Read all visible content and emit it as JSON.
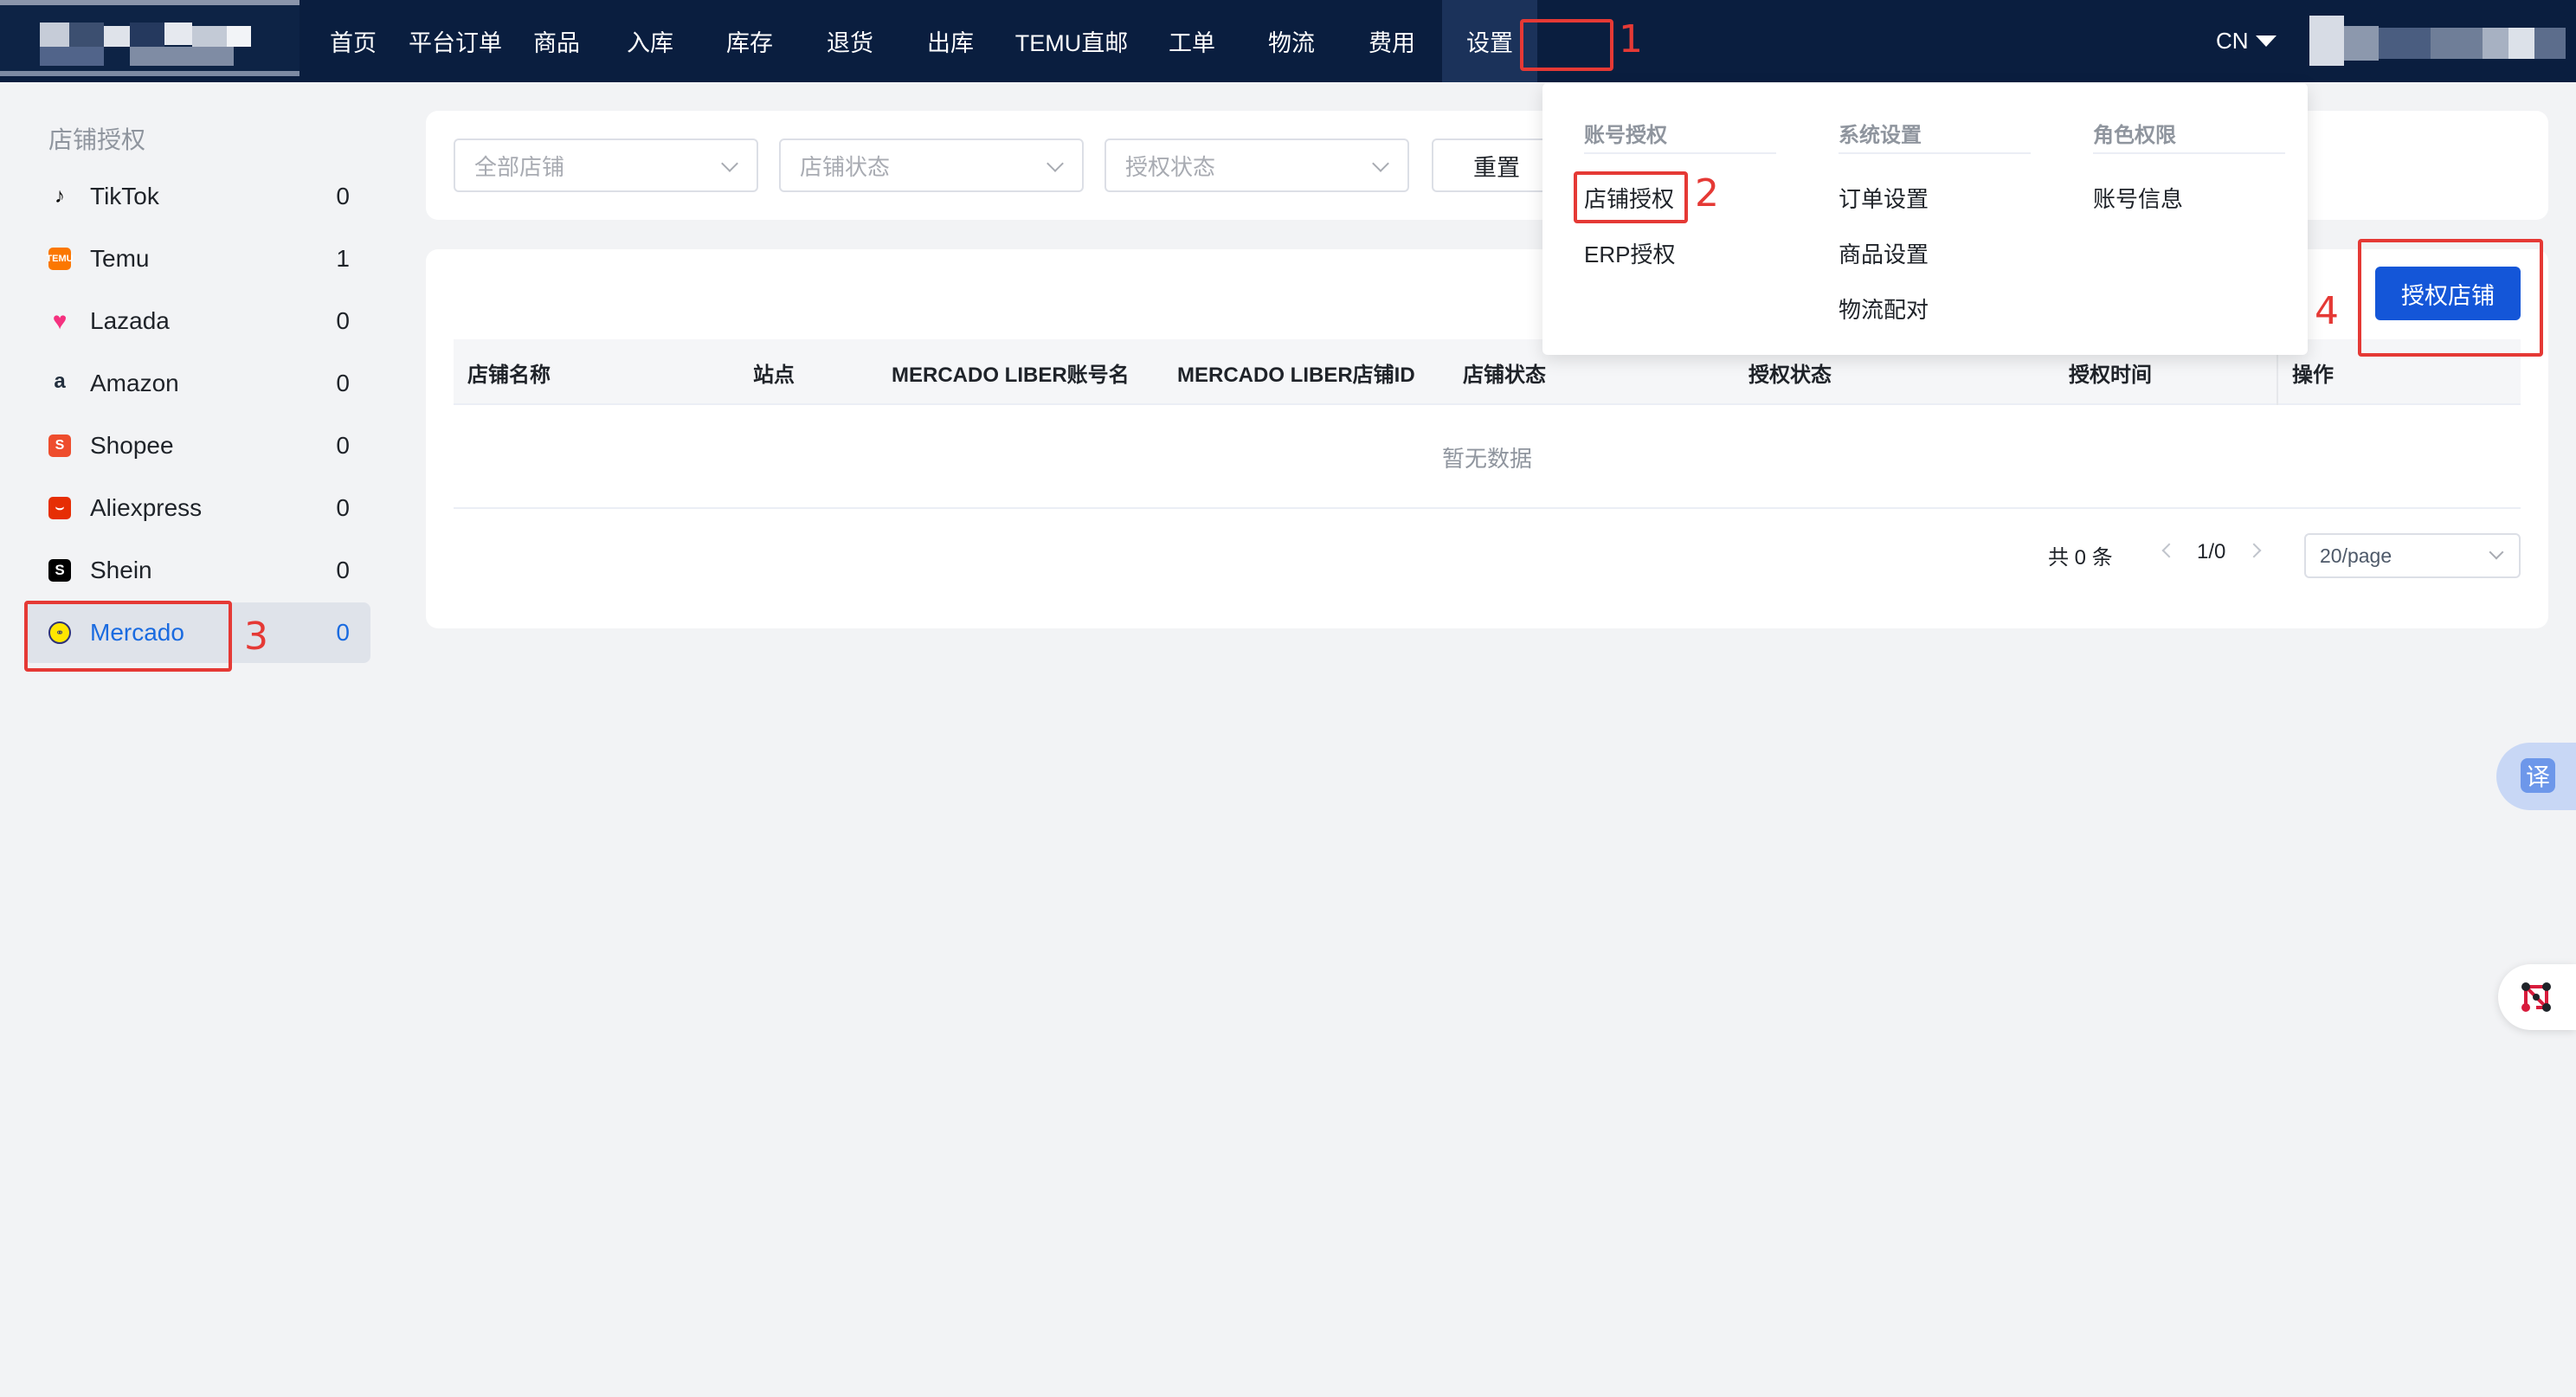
{
  "nav": {
    "items": [
      "首页",
      "平台订单",
      "商品",
      "入库",
      "库存",
      "退货",
      "出库",
      "TEMU直邮",
      "工单",
      "物流",
      "费用",
      "设置"
    ],
    "active": "设置",
    "language": "CN"
  },
  "sidebar": {
    "title": "店铺授权",
    "items": [
      {
        "label": "TikTok",
        "count": "0",
        "icon": "tiktok-icon",
        "color": "#000000"
      },
      {
        "label": "Temu",
        "count": "1",
        "icon": "temu-icon",
        "color": "#fb7701"
      },
      {
        "label": "Lazada",
        "count": "0",
        "icon": "lazada-icon",
        "color": "#f5317f"
      },
      {
        "label": "Amazon",
        "count": "0",
        "icon": "amazon-icon",
        "color": "#232f3e"
      },
      {
        "label": "Shopee",
        "count": "0",
        "icon": "shopee-icon",
        "color": "#ee4d2d"
      },
      {
        "label": "Aliexpress",
        "count": "0",
        "icon": "aliexpress-icon",
        "color": "#e62e04"
      },
      {
        "label": "Shein",
        "count": "0",
        "icon": "shein-icon",
        "color": "#000000"
      },
      {
        "label": "Mercado",
        "count": "0",
        "icon": "mercado-icon",
        "color": "#ffe600"
      }
    ],
    "active": "Mercado"
  },
  "filters": {
    "store": "全部店铺",
    "store_status": "店铺状态",
    "auth_status": "授权状态",
    "reset": "重置"
  },
  "table": {
    "columns": [
      "店铺名称",
      "站点",
      "MERCADO LIBER账号名",
      "MERCADO LIBER店铺ID",
      "店铺状态",
      "授权状态",
      "授权时间",
      "操作"
    ],
    "empty_text": "暂无数据"
  },
  "actions": {
    "authorize_store": "授权店铺"
  },
  "pagination": {
    "total": "共 0 条",
    "current": "1/0",
    "page_size": "20/page"
  },
  "dropdown": {
    "columns": [
      {
        "title": "账号授权",
        "items": [
          "店铺授权",
          "ERP授权"
        ]
      },
      {
        "title": "系统设置",
        "items": [
          "订单设置",
          "商品设置",
          "物流配对"
        ]
      },
      {
        "title": "角色权限",
        "items": [
          "账号信息"
        ]
      }
    ]
  },
  "annotations": [
    "1",
    "2",
    "3",
    "4"
  ],
  "floating": {
    "translate": "译"
  },
  "colors": {
    "nav_bg": "#0a1e3f",
    "primary": "#1456d8",
    "annotation": "#e53935",
    "active_link": "#1a6be0"
  }
}
